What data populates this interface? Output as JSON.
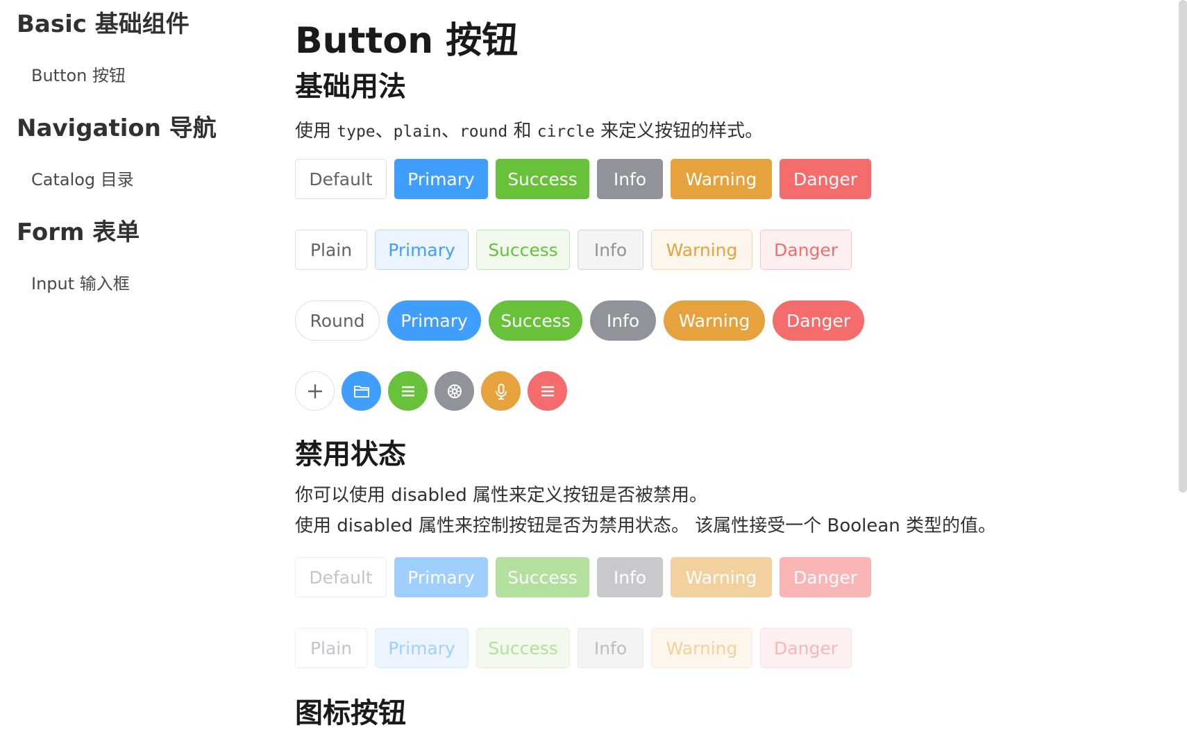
{
  "sidebar": {
    "groups": [
      {
        "title": "Basic 基础组件",
        "items": [
          "Button 按钮"
        ]
      },
      {
        "title": "Navigation 导航",
        "items": [
          "Catalog 目录"
        ]
      },
      {
        "title": "Form 表单",
        "items": [
          "Input 输入框"
        ]
      }
    ]
  },
  "main": {
    "page_title": "Button 按钮",
    "basic": {
      "title": "基础用法",
      "desc_prefix": "使用 ",
      "code_type": "type",
      "sep1": "、",
      "code_plain": "plain",
      "sep2": "、",
      "code_round": "round",
      "and": " 和 ",
      "code_circle": "circle",
      "desc_suffix": " 来定义按钮的样式。",
      "default_row": [
        "Default",
        "Primary",
        "Success",
        "Info",
        "Warning",
        "Danger"
      ],
      "plain_row": [
        "Plain",
        "Primary",
        "Success",
        "Info",
        "Warning",
        "Danger"
      ],
      "round_row": [
        "Round",
        "Primary",
        "Success",
        "Info",
        "Warning",
        "Danger"
      ],
      "circle_icons": [
        "plus-icon",
        "folder-icon",
        "list-icon",
        "settings-icon",
        "microphone-icon",
        "list-icon"
      ]
    },
    "disabled": {
      "title": "禁用状态",
      "desc_line1": "你可以使用 disabled 属性来定义按钮是否被禁用。",
      "desc_line2": "使用 disabled 属性来控制按钮是否为禁用状态。 该属性接受一个 Boolean 类型的值。",
      "default_row": [
        "Default",
        "Primary",
        "Success",
        "Info",
        "Warning",
        "Danger"
      ],
      "plain_row": [
        "Plain",
        "Primary",
        "Success",
        "Info",
        "Warning",
        "Danger"
      ]
    },
    "icon_section": {
      "title": "图标按钮"
    }
  },
  "colors": {
    "primary": "#409eff",
    "success": "#67c23a",
    "info": "#909399",
    "warning": "#e6a23c",
    "danger": "#f56c6c"
  }
}
